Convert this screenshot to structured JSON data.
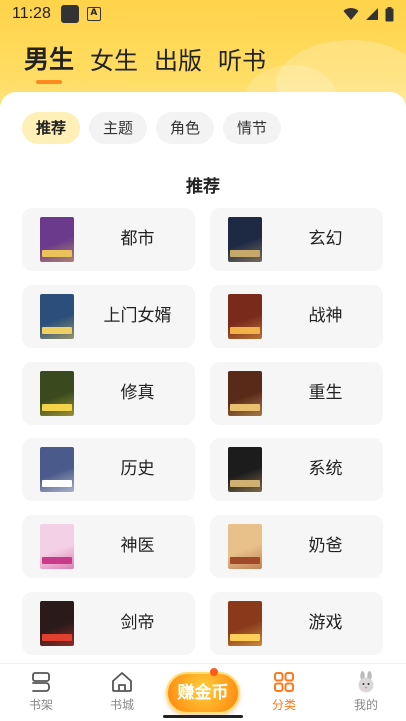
{
  "status_bar": {
    "time": "11:28"
  },
  "main_tabs": [
    {
      "label": "男生",
      "active": true
    },
    {
      "label": "女生",
      "active": false
    },
    {
      "label": "出版",
      "active": false
    },
    {
      "label": "听书",
      "active": false
    }
  ],
  "filter_chips": [
    {
      "label": "推荐",
      "active": true
    },
    {
      "label": "主题",
      "active": false
    },
    {
      "label": "角色",
      "active": false
    },
    {
      "label": "情节",
      "active": false
    }
  ],
  "section": {
    "title": "推荐"
  },
  "categories": [
    {
      "label": "都市",
      "cover_color": "#6b3a8c",
      "cover_accent": "#e9c35a"
    },
    {
      "label": "玄幻",
      "cover_color": "#1e2a44",
      "cover_accent": "#c6a86a"
    },
    {
      "label": "上门女婿",
      "cover_color": "#2b4f7a",
      "cover_accent": "#f0d060"
    },
    {
      "label": "战神",
      "cover_color": "#7a2a1a",
      "cover_accent": "#f2b24a"
    },
    {
      "label": "修真",
      "cover_color": "#3a4a1e",
      "cover_accent": "#f3d34a"
    },
    {
      "label": "重生",
      "cover_color": "#5a2a18",
      "cover_accent": "#e8c070"
    },
    {
      "label": "历史",
      "cover_color": "#4a5a8a",
      "cover_accent": "#ffffff"
    },
    {
      "label": "系统",
      "cover_color": "#1c1c1c",
      "cover_accent": "#d0b070"
    },
    {
      "label": "神医",
      "cover_color": "#f4d0e6",
      "cover_accent": "#c93a8a"
    },
    {
      "label": "奶爸",
      "cover_color": "#e8c08a",
      "cover_accent": "#a04a2a"
    },
    {
      "label": "剑帝",
      "cover_color": "#2a1a1a",
      "cover_accent": "#e04030"
    },
    {
      "label": "游戏",
      "cover_color": "#8a3a1a",
      "cover_accent": "#ffcf5a"
    }
  ],
  "earn_button": {
    "label": "赚金币"
  },
  "bottom_nav": [
    {
      "label": "书架",
      "icon": "bookshelf-icon",
      "active": false
    },
    {
      "label": "书城",
      "icon": "home-icon",
      "active": false
    },
    {
      "label": "分类",
      "icon": "category-grid-icon",
      "active": true
    },
    {
      "label": "我的",
      "icon": "profile-rabbit-icon",
      "active": false
    }
  ],
  "colors": {
    "accent": "#ff7a1a",
    "header_yellow": "#ffd34a",
    "chip_active_bg": "#fff0b8",
    "card_bg": "#f6f6f6"
  }
}
